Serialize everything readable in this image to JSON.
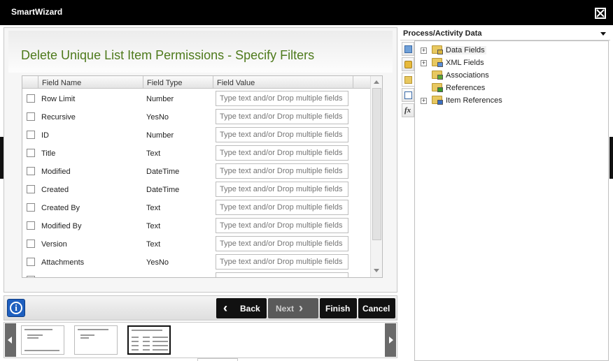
{
  "window": {
    "title": "SmartWizard"
  },
  "wizard": {
    "title": "Delete Unique List Item Permissions - Specify Filters",
    "columns": [
      "Field Name",
      "Field Type",
      "Field Value"
    ],
    "value_placeholder": "Type text and/or Drop multiple fields",
    "rows": [
      {
        "name": "Row Limit",
        "type": "Number"
      },
      {
        "name": "Recursive",
        "type": "YesNo"
      },
      {
        "name": "ID",
        "type": "Number"
      },
      {
        "name": "Title",
        "type": "Text"
      },
      {
        "name": "Modified",
        "type": "DateTime"
      },
      {
        "name": "Created",
        "type": "DateTime"
      },
      {
        "name": "Created By",
        "type": "Text"
      },
      {
        "name": "Modified By",
        "type": "Text"
      },
      {
        "name": "Version",
        "type": "Text"
      },
      {
        "name": "Attachments",
        "type": "YesNo"
      },
      {
        "name": "",
        "type": ""
      }
    ]
  },
  "toolbar": {
    "info_label": "i",
    "back_label": "Back",
    "next_label": "Next",
    "finish_label": "Finish",
    "cancel_label": "Cancel"
  },
  "side_panel": {
    "title": "Process/Activity Data",
    "tabs": [
      "process-data-icon",
      "database-icon",
      "folder-icon",
      "list-icon",
      "function-icon"
    ],
    "tree": [
      {
        "label": "Data Fields",
        "expandable": true,
        "badge_color": "#d9b43c"
      },
      {
        "label": "XML Fields",
        "expandable": true,
        "badge_color": "#5a8dd6"
      },
      {
        "label": "Associations",
        "expandable": false,
        "badge_color": "#5aa832"
      },
      {
        "label": "References",
        "expandable": false,
        "badge_color": "#3a9a2a"
      },
      {
        "label": "Item References",
        "expandable": true,
        "badge_color": "#3a6fc2"
      }
    ]
  },
  "colors": {
    "title_green": "#4e7a1c",
    "titlebar_bg": "#000000",
    "info_blue": "#1e5fbf"
  }
}
